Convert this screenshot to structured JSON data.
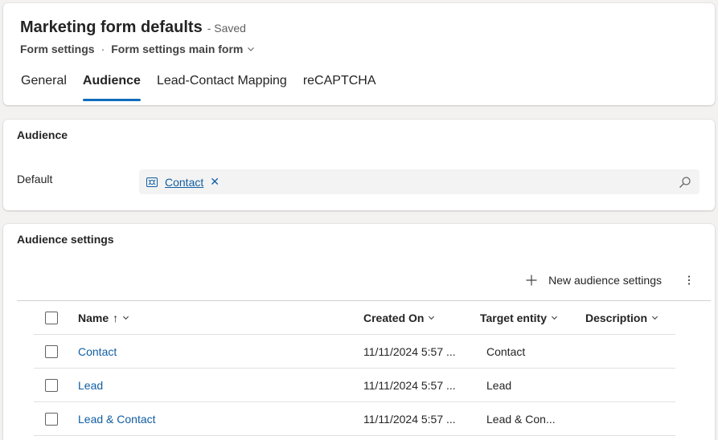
{
  "header": {
    "title": "Marketing form defaults",
    "status": "- Saved",
    "entity_name": "Form settings",
    "separator": "·",
    "form_selector": "Form settings main form",
    "tabs": [
      {
        "label": "General",
        "active": false
      },
      {
        "label": "Audience",
        "active": true
      },
      {
        "label": "Lead-Contact Mapping",
        "active": false
      },
      {
        "label": "reCAPTCHA",
        "active": false
      }
    ]
  },
  "audience": {
    "section_title": "Audience",
    "default_label": "Default",
    "default_value": "Contact",
    "remove_glyph": "✕"
  },
  "audience_settings": {
    "section_title": "Audience settings",
    "new_button_label": "New audience settings",
    "columns": {
      "name": "Name",
      "name_sort": "↑",
      "created_on": "Created On",
      "target_entity": "Target entity",
      "description": "Description"
    },
    "rows": [
      {
        "name": "Contact",
        "created_on": "11/11/2024 5:57 ...",
        "target_entity": "Contact",
        "description": ""
      },
      {
        "name": "Lead",
        "created_on": "11/11/2024 5:57 ...",
        "target_entity": "Lead",
        "description": ""
      },
      {
        "name": "Lead & Contact",
        "created_on": "11/11/2024 5:57 ...",
        "target_entity": "Lead & Con...",
        "description": ""
      }
    ]
  },
  "colors": {
    "accent": "#0f6cbd",
    "link": "#115ea3",
    "page_background": "#f3f2f1"
  }
}
